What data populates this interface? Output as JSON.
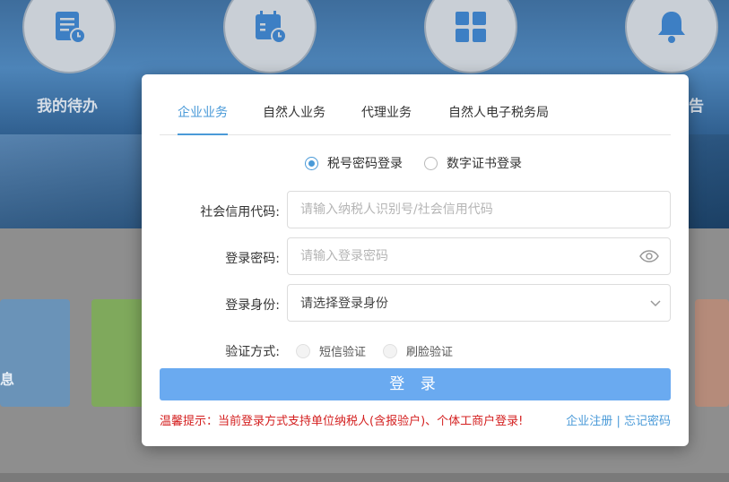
{
  "background": {
    "top_icons": [
      {
        "name": "todo-icon",
        "label": "我的待办"
      },
      {
        "name": "calendar-icon",
        "label": ""
      },
      {
        "name": "grid-icon",
        "label": ""
      },
      {
        "name": "bell-icon",
        "label": "告"
      }
    ],
    "tiles": [
      {
        "color": "#6a93b8",
        "label": "息"
      },
      {
        "color": "#7fa95c",
        "label": ""
      },
      {
        "color": "#b58b7a",
        "label": ""
      }
    ]
  },
  "tabs": [
    {
      "label": "企业业务",
      "active": true
    },
    {
      "label": "自然人业务",
      "active": false
    },
    {
      "label": "代理业务",
      "active": false
    },
    {
      "label": "自然人电子税务局",
      "active": false
    }
  ],
  "login_methods": [
    {
      "label": "税号密码登录",
      "selected": true
    },
    {
      "label": "数字证书登录",
      "selected": false
    }
  ],
  "form": {
    "credit_code": {
      "label": "社会信用代码:",
      "placeholder": "请输入纳税人识别号/社会信用代码"
    },
    "password": {
      "label": "登录密码:",
      "placeholder": "请输入登录密码"
    },
    "identity": {
      "label": "登录身份:",
      "value": "请选择登录身份"
    },
    "verify": {
      "label": "验证方式:",
      "options": [
        "短信验证",
        "刷脸验证"
      ]
    }
  },
  "login_button": "登 录",
  "tip": "温馨提示：当前登录方式支持单位纳税人(含报验户)、个体工商户登录!",
  "links": {
    "register": "企业注册",
    "separator": "|",
    "forgot": "忘记密码"
  },
  "colors": {
    "accent": "#4a9ad8",
    "button": "#6aaaf0",
    "tip": "#d42020"
  }
}
